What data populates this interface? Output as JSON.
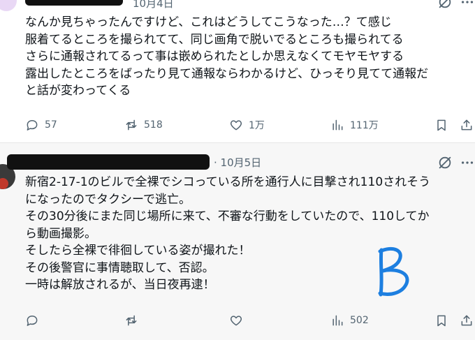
{
  "post1": {
    "date": "10月4日",
    "lines": [
      "なんか見ちゃったんですけど、これはどうしてこうなった…？て感じ",
      "服着てるところを撮られてて、同じ画角で脱いでるところも撮られてる",
      "さらに通報されてるって事は嵌められたとしか思えなくてモヤモヤする",
      "露出したところをばったり見て通報ならわかるけど、ひっそり見てて通報だ",
      "と話が変わってくる"
    ],
    "replies": "57",
    "reposts": "518",
    "likes": "1万",
    "views": "111万",
    "grok_icon": "grok-icon",
    "icons": [
      "reply-icon",
      "repost-icon",
      "like-icon",
      "views-icon",
      "bookmark-icon",
      "share-icon"
    ]
  },
  "post2": {
    "date": "10月5日",
    "lines": [
      "新宿2-17-1のビルで全裸でシコっている所を通行人に目撃され110されそう",
      "になったのでタクシーで逃亡。",
      "その30分後にまた同じ場所に来て、不審な行動をしていたので、110してか",
      "ら動画撮影。",
      "そしたら全裸で徘徊している姿が撮れた！",
      "その後警官に事情聴取して、否認。",
      "一時は解放されるが、当日夜再逮！"
    ],
    "views": "502",
    "grok_icon": "grok-icon",
    "icons": [
      "reply-icon",
      "repost-icon",
      "like-icon",
      "views-icon",
      "bookmark-icon",
      "share-icon"
    ],
    "annotation": "B",
    "annotation_color": "#1d7fe0"
  },
  "colors": {
    "text": "#0f1419",
    "muted": "#536471",
    "post2_bg": "#f7f7f7"
  }
}
